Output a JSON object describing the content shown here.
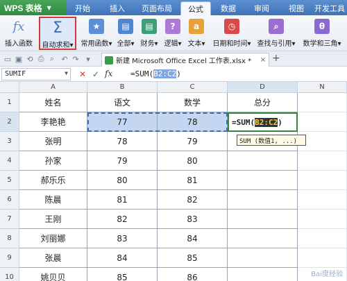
{
  "app": {
    "name": "WPS 表格"
  },
  "ribbon_tabs": [
    "开始",
    "插入",
    "页面布局",
    "公式",
    "数据",
    "审阅",
    "视图",
    "开发工具"
  ],
  "active_tab": "公式",
  "ribbon_buttons": [
    {
      "label": "插入函数",
      "icon": "fx-icon"
    },
    {
      "label": "自动求和",
      "icon": "sigma-icon"
    },
    {
      "label": "常用函数",
      "icon": "star-icon"
    },
    {
      "label": "全部",
      "icon": "book-icon"
    },
    {
      "label": "财务",
      "icon": "book-icon"
    },
    {
      "label": "逻辑",
      "icon": "question-icon"
    },
    {
      "label": "文本",
      "icon": "text-icon"
    },
    {
      "label": "日期和时间",
      "icon": "clock-icon"
    },
    {
      "label": "查找与引用",
      "icon": "search-icon"
    },
    {
      "label": "数学和三角",
      "icon": "theta-icon"
    }
  ],
  "document_tab": {
    "name": "新建 Microsoft Office Excel 工作表.xlsx *"
  },
  "formula_bar": {
    "name_box": "SUMIF",
    "formula_prefix": "=SUM(",
    "formula_ref": "B2:C2",
    "formula_suffix": ")"
  },
  "columns": [
    "A",
    "B",
    "C",
    "D",
    "N"
  ],
  "rows": [
    {
      "num": "1",
      "cells": [
        "姓名",
        "语文",
        "数学",
        "总分"
      ]
    },
    {
      "num": "2",
      "cells": [
        "李艳艳",
        "77",
        "78",
        ""
      ]
    },
    {
      "num": "3",
      "cells": [
        "张明",
        "78",
        "79",
        ""
      ]
    },
    {
      "num": "4",
      "cells": [
        "孙家",
        "79",
        "80",
        ""
      ]
    },
    {
      "num": "5",
      "cells": [
        "郝乐乐",
        "80",
        "81",
        ""
      ]
    },
    {
      "num": "6",
      "cells": [
        "陈晨",
        "81",
        "82",
        ""
      ]
    },
    {
      "num": "7",
      "cells": [
        "王刚",
        "82",
        "83",
        ""
      ]
    },
    {
      "num": "8",
      "cells": [
        "刘丽娜",
        "83",
        "84",
        ""
      ]
    },
    {
      "num": "9",
      "cells": [
        "张晨",
        "84",
        "85",
        ""
      ]
    },
    {
      "num": "10",
      "cells": [
        "姚贝贝",
        "85",
        "86",
        ""
      ]
    }
  ],
  "editing_cell": {
    "prefix": "=SUM(",
    "ref": "B2:C2",
    "suffix": ")"
  },
  "tooltip": "SUM (数值1, ...)",
  "colors": {
    "accent": "#3f73b8",
    "highlight_border": "#d23a3a",
    "edit_border": "#2f8a3f"
  }
}
